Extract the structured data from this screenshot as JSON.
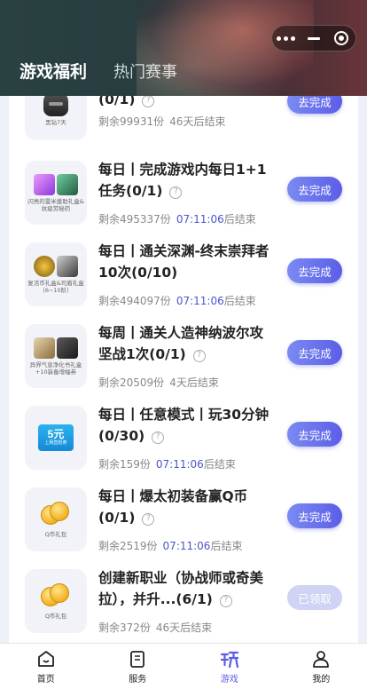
{
  "header": {
    "tabs": [
      {
        "label": "游戏福利",
        "active": true
      },
      {
        "label": "热门赛事",
        "active": false
      }
    ]
  },
  "capsule": {
    "icons": [
      "more-dots-icon",
      "minimize-icon",
      "close-target-icon"
    ]
  },
  "tasks": [
    {
      "title": "(0/1)",
      "thumb_label": "黑钻7天",
      "thumb_icon": "helmet-icon",
      "remaining": "剩余99931份",
      "time": "",
      "ends": "46天后结束",
      "button": "去完成",
      "claimed": false
    },
    {
      "title": "每日丨完成游戏内每日1+1任务(0/1)",
      "thumb_label": "闪亮的雷米援助礼盒&抗疲劳秘药",
      "thumb_icon": "gift-box-icon",
      "remaining": "剩余495337份",
      "time": "07:11:06",
      "ends": "后结束",
      "button": "去完成",
      "claimed": false
    },
    {
      "title": "每日丨通关深渊-终末崇拜者10次(0/10)",
      "thumb_label": "复活币礼盒&司盾礼盒（6~10阶）",
      "thumb_icon": "coin-box-icon",
      "remaining": "剩余494097份",
      "time": "07:11:06",
      "ends": "后结束",
      "button": "去完成",
      "claimed": false
    },
    {
      "title": "每周丨通关人造神纳波尔攻坚战1次(0/1)",
      "thumb_label": "异界气息净化书礼盒+10装备增幅券",
      "thumb_icon": "scroll-box-icon",
      "remaining": "剩余20509份",
      "time": "",
      "ends": "4天后结束",
      "button": "去完成",
      "claimed": false
    },
    {
      "title": "每日丨任意模式丨玩30分钟(0/30)",
      "thumb_label": "",
      "thumb_icon": "ticket-icon",
      "ticket_value": "5元",
      "ticket_caption": "上网直抵券",
      "remaining": "剩余159份",
      "time": "07:11:06",
      "ends": "后结束",
      "button": "去完成",
      "claimed": false
    },
    {
      "title": "每日丨爆太初装备赢Q币(0/1)",
      "thumb_label": "Q币礼包",
      "thumb_icon": "qcoin-icon",
      "remaining": "剩余2519份",
      "time": "07:11:06",
      "ends": "后结束",
      "button": "去完成",
      "claimed": false
    },
    {
      "title": "创建新职业（协战师或奇美拉），并升...(6/1)",
      "thumb_label": "Q币礼包",
      "thumb_icon": "qcoin-icon",
      "remaining": "剩余372份",
      "time": "",
      "ends": "46天后结束",
      "button": "已领取",
      "claimed": true
    }
  ],
  "help_glyph": "?",
  "navbar": {
    "items": [
      {
        "label": "首页",
        "icon": "home-icon",
        "active": false
      },
      {
        "label": "服务",
        "icon": "service-icon",
        "active": false
      },
      {
        "label": "游戏",
        "icon": "game-icon",
        "active": true
      },
      {
        "label": "我的",
        "icon": "profile-icon",
        "active": false
      }
    ]
  },
  "colors": {
    "accent": "#5b5ee6",
    "accent_light": "#7b8af2",
    "claimed": "#cfd3f4",
    "time": "#4a56c9"
  }
}
